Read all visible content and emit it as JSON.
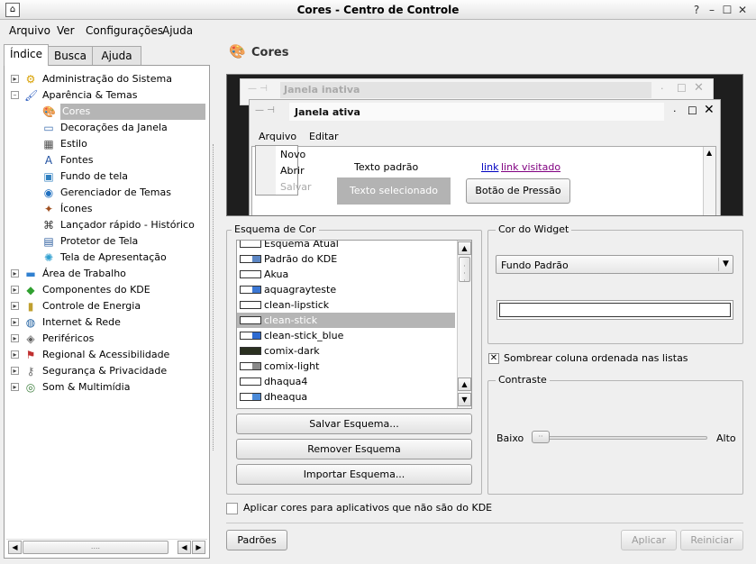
{
  "window": {
    "title": "Cores - Centro de Controle"
  },
  "menu": [
    "Arquivo",
    "Ver",
    "Configurações",
    "Ajuda"
  ],
  "tabs": [
    "Índice",
    "Busca",
    "Ajuda"
  ],
  "tree": [
    {
      "label": "Administração do Sistema",
      "icon": "admin-icon",
      "glyph": "⚙",
      "color": "#d8a000"
    },
    {
      "label": "Aparência & Temas",
      "icon": "appearance-icon",
      "glyph": "🖌",
      "color": "#3060c0"
    },
    {
      "label": "Cores",
      "icon": "colors-icon",
      "glyph": "🎨",
      "color": "#c08030"
    },
    {
      "label": "Decorações da Janela",
      "icon": "window-decorations-icon",
      "glyph": "▭",
      "color": "#4070b0"
    },
    {
      "label": "Estilo",
      "icon": "style-icon",
      "glyph": "▦",
      "color": "#505050"
    },
    {
      "label": "Fontes",
      "icon": "fonts-icon",
      "glyph": "A",
      "color": "#2050a0"
    },
    {
      "label": "Fundo de tela",
      "icon": "wallpaper-icon",
      "glyph": "▣",
      "color": "#3080c0"
    },
    {
      "label": "Gerenciador de Temas",
      "icon": "theme-manager-icon",
      "glyph": "◉",
      "color": "#2070c0"
    },
    {
      "label": "Ícones",
      "icon": "icons-icon",
      "glyph": "✦",
      "color": "#a05020"
    },
    {
      "label": "Lançador rápido - Histórico",
      "icon": "launcher-icon",
      "glyph": "⌘",
      "color": "#333"
    },
    {
      "label": "Protetor de Tela",
      "icon": "screensaver-icon",
      "glyph": "▤",
      "color": "#3060a0"
    },
    {
      "label": "Tela de Apresentação",
      "icon": "splash-icon",
      "glyph": "✺",
      "color": "#30a0d0"
    },
    {
      "label": "Área de Trabalho",
      "icon": "desktop-icon",
      "glyph": "▬",
      "color": "#3080d0"
    },
    {
      "label": "Componentes do KDE",
      "icon": "kde-components-icon",
      "glyph": "◆",
      "color": "#30a030"
    },
    {
      "label": "Controle de Energia",
      "icon": "power-icon",
      "glyph": "▮",
      "color": "#c0a030"
    },
    {
      "label": "Internet & Rede",
      "icon": "network-icon",
      "glyph": "◍",
      "color": "#2060a0"
    },
    {
      "label": "Periféricos",
      "icon": "peripherals-icon",
      "glyph": "◈",
      "color": "#606060"
    },
    {
      "label": "Regional & Acessibilidade",
      "icon": "regional-icon",
      "glyph": "⚑",
      "color": "#c03030"
    },
    {
      "label": "Segurança & Privacidade",
      "icon": "security-icon",
      "glyph": "⚷",
      "color": "#707070"
    },
    {
      "label": "Som & Multimídia",
      "icon": "sound-icon",
      "glyph": "◎",
      "color": "#408040"
    }
  ],
  "header": {
    "title": "Cores"
  },
  "preview": {
    "inactive_title": "Janela inativa",
    "active_title": "Janela ativa",
    "menu_file": "Arquivo",
    "menu_edit": "Editar",
    "menu_new": "Novo",
    "menu_open": "Abrir",
    "menu_save": "Salvar",
    "normal_text": "Texto padrão",
    "selected_text": "Texto selecionado",
    "link": "link",
    "visited_link": "link visitado",
    "push_button": "Botão de Pressão"
  },
  "scheme": {
    "title": "Esquema de Cor",
    "items": [
      {
        "name": "Esquema Atual",
        "c1": "#ffffff",
        "c2": "#ffffff"
      },
      {
        "name": "Padrão do KDE",
        "c1": "#ffffff",
        "c2": "#5c86c4"
      },
      {
        "name": "Akua",
        "c1": "#ffffff",
        "c2": "#ffffff"
      },
      {
        "name": "aquagrayteste",
        "c1": "#ffffff",
        "c2": "#3b77d3"
      },
      {
        "name": "clean-lipstick",
        "c1": "#ffffff",
        "c2": "#ffffff"
      },
      {
        "name": "clean-stick",
        "c1": "#ffffff",
        "c2": "#ffffff"
      },
      {
        "name": "clean-stick_blue",
        "c1": "#ffffff",
        "c2": "#2d6ad0"
      },
      {
        "name": "comix-dark",
        "c1": "#2a3020",
        "c2": "#2a3020"
      },
      {
        "name": "comix-light",
        "c1": "#ffffff",
        "c2": "#8a8a8a"
      },
      {
        "name": "dhaqua4",
        "c1": "#ffffff",
        "c2": "#ffffff"
      },
      {
        "name": "dheaqua",
        "c1": "#ffffff",
        "c2": "#4a8ad8"
      }
    ],
    "selected": "clean-stick",
    "save_label": "Salvar Esquema...",
    "remove_label": "Remover Esquema",
    "import_label": "Importar Esquema..."
  },
  "widget": {
    "title": "Cor do Widget",
    "selected": "Fundo Padrão",
    "shade_label": "Sombrear coluna ordenada nas listas",
    "shade_checked": true
  },
  "contrast": {
    "title": "Contraste",
    "low": "Baixo",
    "high": "Alto",
    "value": 0.0
  },
  "apply_non_kde": "Aplicar cores para aplicativos que não são do KDE",
  "buttons": {
    "defaults": "Padrões",
    "apply": "Aplicar",
    "reset": "Reiniciar"
  },
  "hscroll_grip": "...."
}
